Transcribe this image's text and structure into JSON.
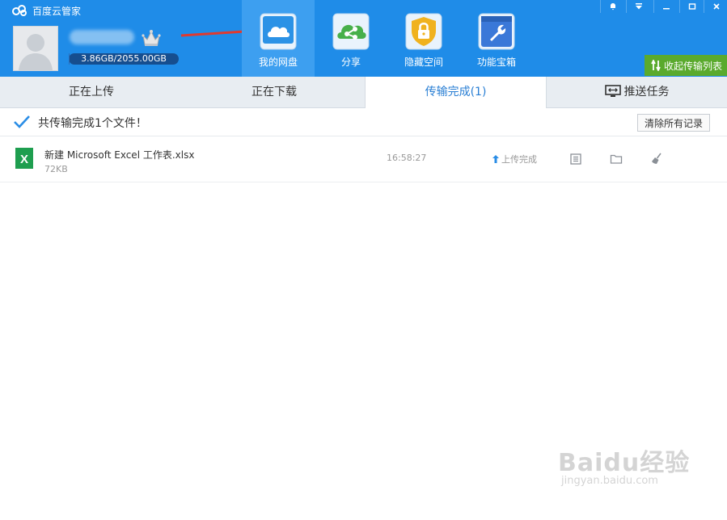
{
  "app": {
    "title": "百度云管家"
  },
  "user": {
    "quota_text": "3.86GB/2055.00GB",
    "quota_used_fraction": 0.0019
  },
  "nav": [
    {
      "label": "我的网盘",
      "icon": "cloud-icon",
      "active": true
    },
    {
      "label": "分享",
      "icon": "share-icon",
      "active": false
    },
    {
      "label": "隐藏空间",
      "icon": "lock-icon",
      "active": false
    },
    {
      "label": "功能宝箱",
      "icon": "wrench-icon",
      "active": false
    }
  ],
  "header": {
    "collapse_label": "收起传输列表"
  },
  "tabs": [
    {
      "label": "正在上传"
    },
    {
      "label": "正在下载"
    },
    {
      "label": "传输完成(1)"
    },
    {
      "label": "推送任务"
    }
  ],
  "summary": {
    "text": "共传输完成1个文件！",
    "clear_label": "清除所有记录"
  },
  "files": [
    {
      "name": "新建 Microsoft Excel 工作表.xlsx",
      "size": "72KB",
      "time": "16:58:27",
      "status": "上传完成",
      "icon_letter": "X"
    }
  ],
  "watermark": {
    "brand": "Baidu经验",
    "url": "jingyan.baidu.com"
  },
  "colors": {
    "header_bg": "#1f8ce8",
    "active_nav_bg": "#3d9ff0",
    "collapse_bg": "#5aaa2d",
    "accent_tab": "#2a7fd4",
    "excel_green": "#1e9e4f"
  }
}
